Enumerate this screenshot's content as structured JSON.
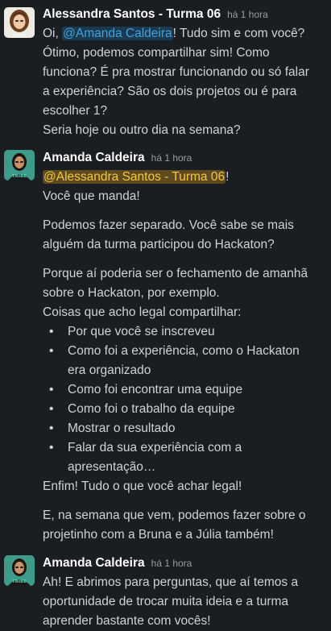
{
  "messages": [
    {
      "author": "Alessandra Santos - Turma 06",
      "time": "há 1 hora",
      "avatar_icon": "user-avatar-woman-light",
      "lines": {
        "l1_pre": "Oi, ",
        "l1_mention": "@Amanda Caldeira",
        "l1_post": "! Tudo sim e com você?",
        "l2": "Ótimo, podemos compartilhar sim! Como",
        "l3": "funciona? É pra mostrar funcionando ou só falar",
        "l4": "a experiência? São os dois projetos ou é para",
        "l5": "escolher 1?",
        "l6": "Seria hoje ou outro dia na semana?"
      }
    },
    {
      "author": "Amanda Caldeira",
      "time": "há 1 hora",
      "avatar_icon": "user-avatar-woman-tribe-shirt",
      "mention": "@Alessandra Santos - Turma 06",
      "mention_post": "!",
      "p1": "Você que manda!",
      "p2a": "Podemos fazer separado. Você sabe se mais",
      "p2b": "alguém da turma participou do Hackaton?",
      "p3a": "Porque aí poderia ser o fechamento de amanhã",
      "p3b": "sobre o Hackaton, por exemplo.",
      "p3c": "Coisas que acho legal compartilhar:",
      "bullets": [
        "Por que você se inscreveu",
        "Como foi a experiência, como o Hackaton",
        "era organizado",
        "Como foi encontrar uma equipe",
        "Como foi o trabalho da equipe",
        "Mostrar o resultado",
        "Falar da sua experiência com a",
        "apresentação…"
      ],
      "p4": "Enfim! Tudo o que você achar legal!",
      "p5a": "E, na semana que vem, podemos fazer sobre o",
      "p5b": "projetinho com a Bruna e a Júlia também!"
    },
    {
      "author": "Amanda Caldeira",
      "time": "há 1 hora",
      "avatar_icon": "user-avatar-woman-tribe-shirt",
      "l1": "Ah! E abrimos para perguntas, que aí temos a",
      "l2": "oportunidade de trocar muita ideia e a turma",
      "l3": "aprender bastante com vocês!"
    }
  ],
  "avatar_text": "TRIBE",
  "bullet_char": "•",
  "colors": {
    "background": "#1a1d21",
    "text": "#d1d2d3",
    "mention_blue": "#41a3d9",
    "mention_gold": "#f2c744"
  }
}
